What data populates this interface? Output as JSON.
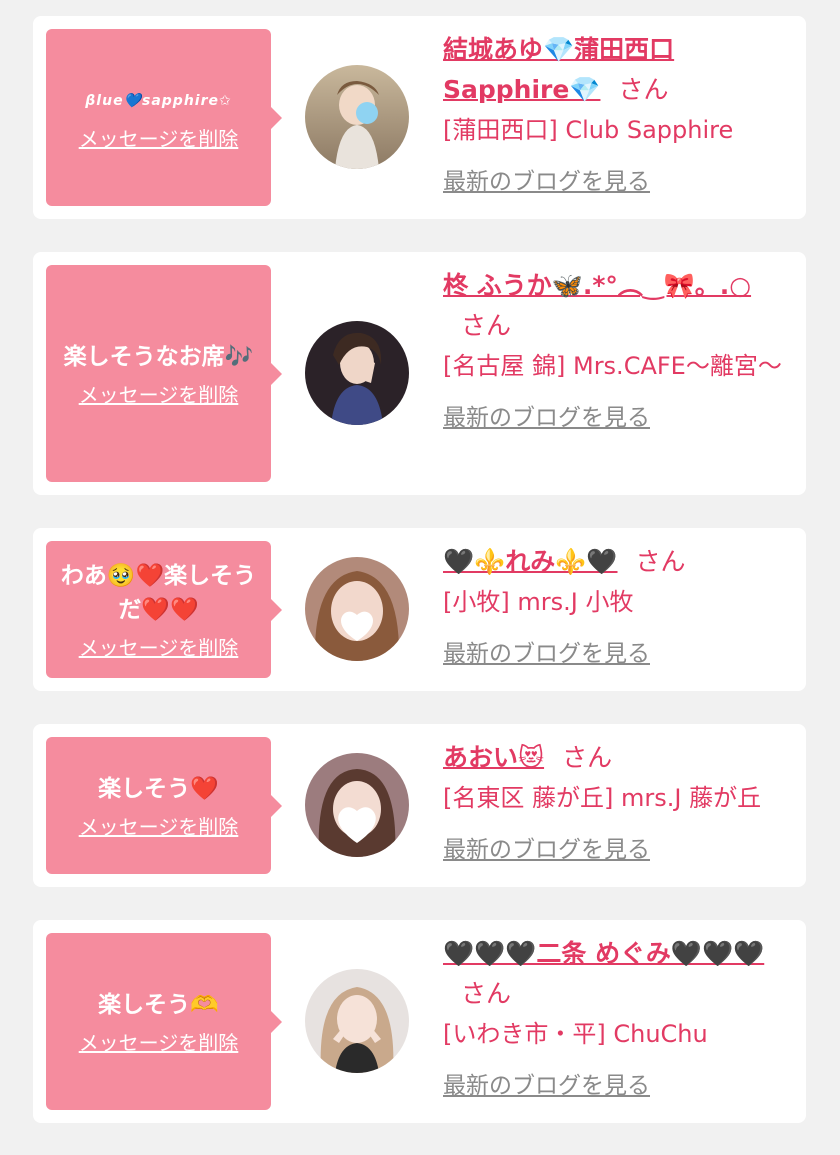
{
  "delete_label": "メッセージを削除",
  "blog_label": "最新のブログを見る",
  "san_label": "さん",
  "colors": {
    "bubble": "#f58c9e",
    "accent": "#e23a63",
    "link_gray": "#8a8a8a",
    "page_bg": "#f1f1f1"
  },
  "items": [
    {
      "message": "βlue💙sapphire✩",
      "name": "結城あゆ💎蒲田西口Sapphire💎",
      "shop": "[蒲田西口] Club Sapphire"
    },
    {
      "message": "楽しそうなお席🎶",
      "name": "柊 ふうか🦋.*°︵‿🎀。.○",
      "shop": "[名古屋 錦] Mrs.CAFE～離宮～"
    },
    {
      "message": "わあ🥹❤️楽しそうだ❤️❤️",
      "name": "🖤⚜️れみ⚜️🖤",
      "shop": "[小牧] mrs.J 小牧"
    },
    {
      "message": "楽しそう❤️",
      "name": "あおい😻",
      "shop": "[名東区 藤が丘] mrs.J 藤が丘"
    },
    {
      "message": "楽しそう🫶",
      "name": "🖤🖤🖤二条 めぐみ🖤🖤🖤",
      "shop": "[いわき市・平] ChuChu"
    }
  ]
}
